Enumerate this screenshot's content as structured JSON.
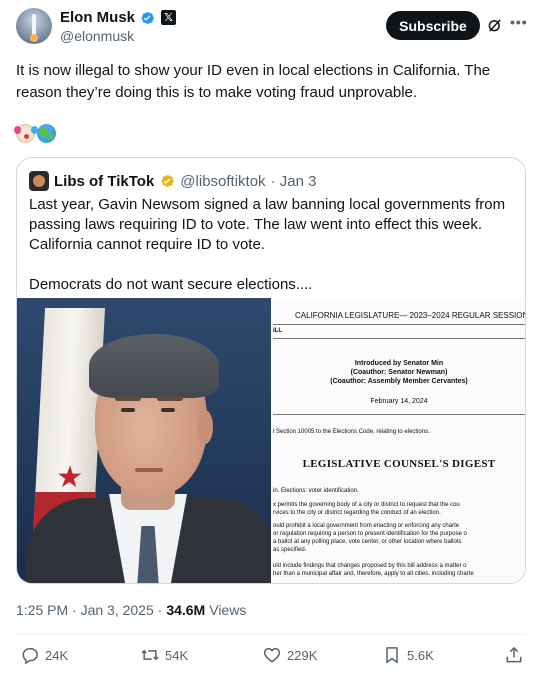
{
  "author": {
    "name": "Elon Musk",
    "handle": "@elonmusk",
    "subscribe_label": "Subscribe"
  },
  "tweet": {
    "text": "It is now illegal to show your ID even in local elections in California. The reason they’re doing this is to make voting fraud unprovable.",
    "emojis": [
      "clown-face-emoji",
      "globe-emoji"
    ]
  },
  "quoted": {
    "name": "Libs of TikTok",
    "handle": "@libsoftiktok",
    "date": "· Jan 3",
    "paragraphs": [
      "Last year, Gavin Newsom signed a law banning local governments from passing laws requiring ID to vote. The law went into effect this week. California cannot require ID to vote.",
      "Democrats do not want secure elections...."
    ],
    "document": {
      "header": "CALIFORNIA LEGISLATURE— 2023–2024 REGULAR SESSION",
      "bill_fragment": "ILL",
      "introduced": "Introduced by Senator Min",
      "coauthor1": "(Coauthor: Senator Newman)",
      "coauthor2": "(Coauthor: Assembly Member Cervantes)",
      "date": "February 14, 2024",
      "section": "l Section 10005 to the Elections Code, relating to elections.",
      "digest_title": "LEGISLATIVE COUNSEL'S DIGEST",
      "topic": "in. Elections: voter identification.",
      "lines": [
        "x permits the governing body of a city or district to request that the cou",
        "rvices to the city or district regarding the conduct of an election.",
        "ould prohibit a local government from enacting or enforcing any charte",
        "or regulation requiring a person to present identification for the purpose o",
        "a ballot at any polling place, vote center, or other location where ballots",
        "as specified.",
        "uld include findings that changes proposed by this bill address a matter o",
        "her than a municipal affair and, therefore, apply to all cities, including charte"
      ]
    }
  },
  "meta": {
    "time": "1:25 PM · Jan 3, 2025 ·",
    "views_count": "34.6M",
    "views_label": "Views"
  },
  "actions": {
    "replies": "24K",
    "reposts": "54K",
    "likes": "229K",
    "bookmarks": "5.6K"
  },
  "colors": {
    "text": "#0f1419",
    "secondary": "#536471",
    "border": "#cfd9de",
    "verified_blue": "#1d9bf0",
    "verified_gold": "#e2b719"
  }
}
